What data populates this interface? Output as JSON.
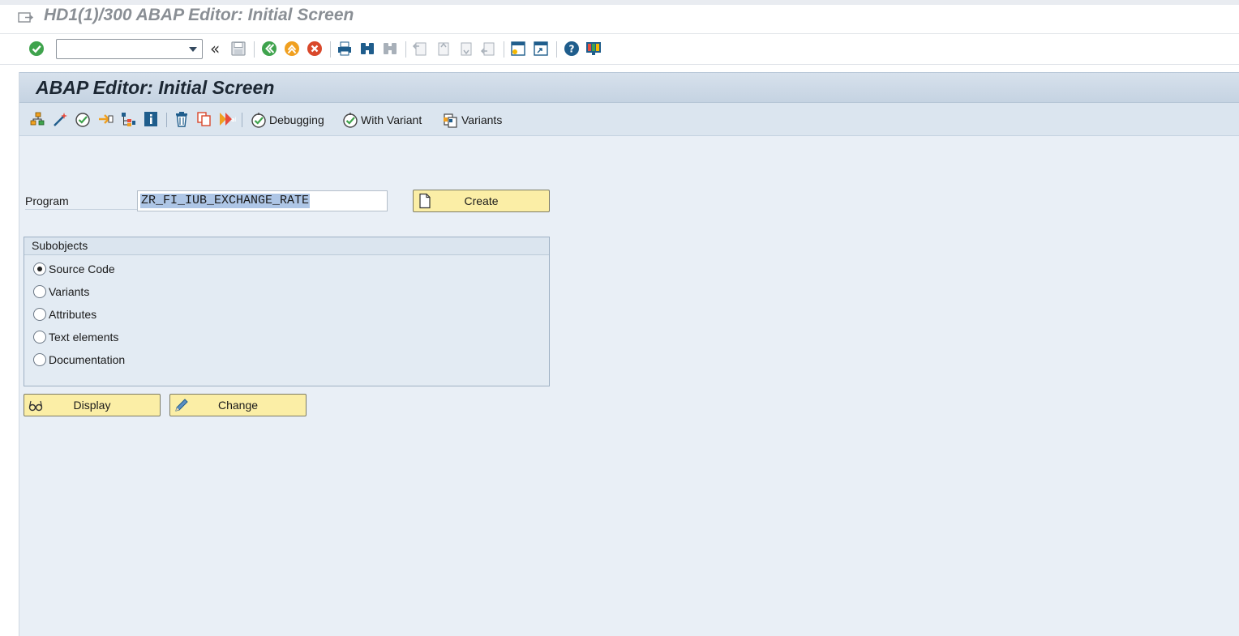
{
  "window": {
    "title": "HD1(1)/300 ABAP Editor: Initial Screen"
  },
  "system_toolbar": {
    "command_field": {
      "value": "",
      "placeholder": ""
    },
    "history_chevron": "«",
    "icons": [
      "enter-icon",
      "save-icon",
      "back-icon",
      "exit-icon",
      "cancel-icon",
      "print-icon",
      "find-icon",
      "find-next-icon",
      "first-page-icon",
      "previous-page-icon",
      "next-page-icon",
      "last-page-icon",
      "create-session-icon",
      "shortcut-icon",
      "help-icon",
      "customize-layout-icon"
    ]
  },
  "screen": {
    "title": "ABAP Editor: Initial Screen",
    "app_toolbar": {
      "icons": [
        "object-list-icon",
        "magic-wand-icon",
        "check-icon",
        "activate-icon",
        "where-used-icon",
        "info-icon",
        "delete-icon",
        "copy-icon",
        "rename-icon"
      ],
      "debugging_label": "Debugging",
      "with_variant_label": "With Variant",
      "variants_label": "Variants"
    },
    "program": {
      "label": "Program",
      "value": "ZR_FI_IUB_EXCHANGE_RATE"
    },
    "create_button": "Create",
    "subobjects": {
      "title": "Subobjects",
      "options": [
        {
          "label": "Source Code",
          "selected": true
        },
        {
          "label": "Variants",
          "selected": false
        },
        {
          "label": "Attributes",
          "selected": false
        },
        {
          "label": "Text elements",
          "selected": false
        },
        {
          "label": "Documentation",
          "selected": false
        }
      ]
    },
    "display_button": "Display",
    "change_button": "Change"
  },
  "colors": {
    "button_yellow": "#fbeea6",
    "screen_background": "#e9eff6",
    "title_grey": "#8a8f95"
  }
}
